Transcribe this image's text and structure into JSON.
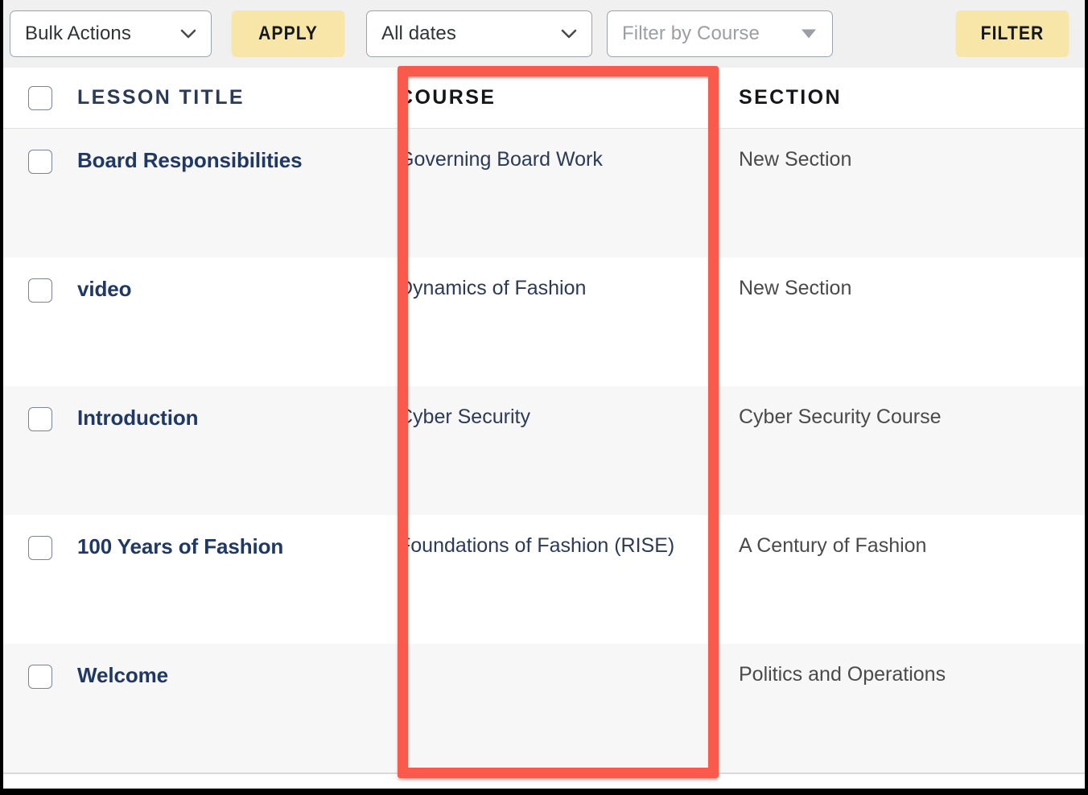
{
  "toolbar": {
    "bulk_actions": {
      "value": "Bulk Actions",
      "icon": "chevron-down-icon"
    },
    "apply_button": "APPLY",
    "date_filter": {
      "value": "All dates",
      "icon": "chevron-down-icon"
    },
    "course_filter": {
      "placeholder": "Filter by Course",
      "value": "",
      "icon": "caret-down-icon"
    },
    "filter_button": "FILTER"
  },
  "table": {
    "columns": [
      {
        "key": "select",
        "label": ""
      },
      {
        "key": "lesson_title",
        "label": "LESSON TITLE"
      },
      {
        "key": "course",
        "label": "COURSE"
      },
      {
        "key": "section",
        "label": "SECTION"
      }
    ],
    "rows": [
      {
        "selected": false,
        "lesson_title": "Board Responsibilities",
        "course": "Governing Board Work",
        "section": "New Section"
      },
      {
        "selected": false,
        "lesson_title": "video",
        "course": "Dynamics of Fashion",
        "section": "New Section"
      },
      {
        "selected": false,
        "lesson_title": "Introduction",
        "course": "Cyber Security",
        "section": "Cyber Security Course"
      },
      {
        "selected": false,
        "lesson_title": "100 Years of Fashion",
        "course": "Foundations of Fashion (RISE)",
        "section": "A Century of Fashion"
      },
      {
        "selected": false,
        "lesson_title": "Welcome",
        "course": "",
        "section": "Politics and Operations"
      }
    ]
  },
  "annotation": {
    "type": "highlight-rectangle",
    "target_column": "COURSE",
    "color": "#fa5a4b"
  },
  "colors": {
    "accent_yellow": "#f8e6a8",
    "highlight_red": "#fa5a4b",
    "link_navy": "#2b3a55",
    "title_navy": "#1f3864",
    "toolbar_bg": "#f0f0f0",
    "row_stripe": "#f7f7f8"
  }
}
